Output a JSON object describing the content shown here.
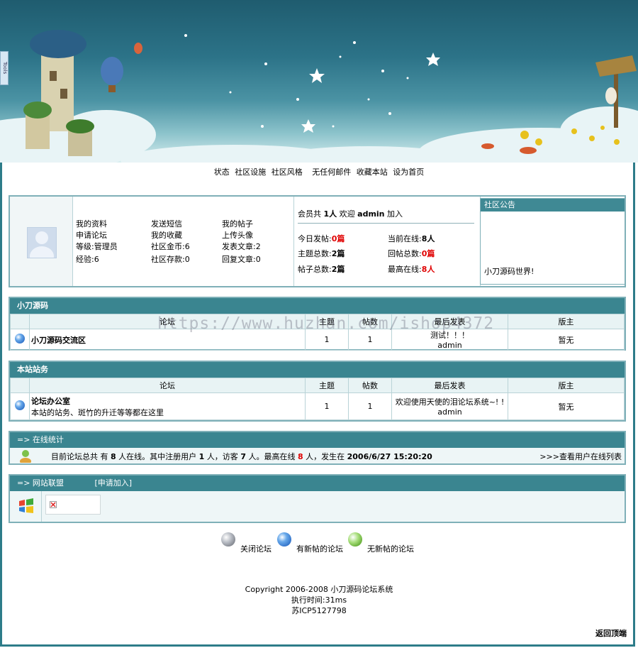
{
  "side_tab": "Tools",
  "topnav": [
    "状态",
    "社区设施",
    "社区风格",
    "无任何邮件",
    "收藏本站",
    "设为首页"
  ],
  "user_links": {
    "col1": [
      "我的资料",
      "申请论坛",
      "等级:管理员",
      "经验:6"
    ],
    "col2": [
      "发送短信",
      "我的收藏",
      "社区金币:6",
      "社区存款:0"
    ],
    "col3": [
      "我的帖子",
      "上传头像",
      "发表文章:2",
      "回复文章:0"
    ]
  },
  "stats": {
    "members_prefix": "会员共",
    "members_count": "1人",
    "welcome": "欢迎",
    "newest_user": "admin",
    "join": "加入",
    "today_label": "今日发帖:",
    "today_value": "0篇",
    "online_label": "当前在线:",
    "online_value": "8人",
    "topics_label": "主题总数:",
    "topics_value": "2篇",
    "replies_label": "回帖总数:",
    "replies_value": "0篇",
    "posts_label": "帖子总数:",
    "posts_value": "2篇",
    "max_online_label": "最高在线:",
    "max_online_value": "8人"
  },
  "notice": {
    "title": "社区公告",
    "text": "小刀源码世界!"
  },
  "forum_headers": [
    "论坛",
    "主题",
    "帖数",
    "最后发表",
    "版主"
  ],
  "category1": {
    "title": "小刀源码",
    "rows": [
      {
        "name": "小刀源码交流区",
        "desc": "",
        "topics": "1",
        "posts": "1",
        "last": "测试！！！",
        "last_user": "admin",
        "mod": "暂无"
      }
    ]
  },
  "category2": {
    "title": "本站站务",
    "rows": [
      {
        "name": "论坛办公室",
        "desc": "本站的站务、斑竹的升迁等等都在这里",
        "topics": "1",
        "posts": "1",
        "last": "欢迎使用天使的泪论坛系统~! !",
        "last_user": "admin",
        "mod": "暂无"
      }
    ]
  },
  "online": {
    "title": "=> 在线统计",
    "text_a": "目前论坛总共 有",
    "total": "8",
    "text_b": "人在线。其中注册用户",
    "registered": "1",
    "text_c": "人，访客",
    "guests": "7",
    "text_d": "人。最高在线",
    "max": "8",
    "text_e": "人，发生在",
    "time": "2006/6/27 15:20:20",
    "list_link": ">>>查看用户在线列表"
  },
  "links_box": {
    "title": "=> 网站联盟",
    "apply": "[申请加入]"
  },
  "legend": [
    "关闭论坛",
    "有新帖的论坛",
    "无新帖的论坛"
  ],
  "footer": {
    "copyright": "Copyright 2006-2008 小刀源码论坛系统",
    "exec_time": "执行时间:31ms",
    "icp": "苏ICP5127798"
  },
  "back_to_top": "返回顶端",
  "watermark": "https://www.huzhan.com/ishop4372"
}
